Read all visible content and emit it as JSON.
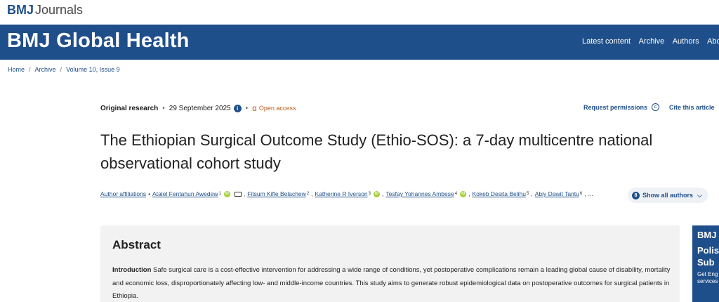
{
  "brand": {
    "bmj": "BMJ",
    "journals": "Journals"
  },
  "header": {
    "title": "BMJ Global Health",
    "nav": [
      "Latest content",
      "Archive",
      "Authors",
      "About"
    ]
  },
  "breadcrumb": [
    "Home",
    "Archive",
    "Volume 10, Issue 9"
  ],
  "meta": {
    "type": "Original research",
    "date": "29 September 2025",
    "info_icon": "i",
    "access": "Open access",
    "request_permissions": "Request permissions",
    "cite": "Cite this article"
  },
  "article": {
    "title": "The Ethiopian Surgical Outcome Study (Ethio-SOS): a 7-day multicentre national observational cohort study"
  },
  "authors": {
    "affiliations_label": "Author affiliations",
    "list": [
      {
        "name": "Atalel Fentahun Awedew",
        "sup": "1"
      },
      {
        "name": "Fitsum Kifle Belachew",
        "sup": "2"
      },
      {
        "name": "Katherine R Iverson",
        "sup": "3"
      },
      {
        "name": "Tesfay Yohannes Ambese",
        "sup": "4"
      },
      {
        "name": "Kokeb Desita Belihu",
        "sup": "5"
      },
      {
        "name": "Abiy Dawit Tantu",
        "sup": "6"
      }
    ],
    "ellipsis": "...",
    "show_all": {
      "count": "8",
      "label": "Show all authors"
    }
  },
  "abstract": {
    "heading": "Abstract",
    "intro_label": "Introduction",
    "intro_text": " Safe surgical care is a cost-effective intervention for addressing a wide range of conditions, yet postoperative complications remain a leading global cause of disability, mortality and economic loss, disproportionately affecting low- and middle-income countries. This study aims to generate robust epidemiological data on postoperative outcomes for surgical patients in Ethiopia."
  },
  "ad": {
    "l1": "BMJ",
    "l2": "Polis",
    "l3": "Sub",
    "l4": "Get Eng",
    "l5": "services"
  },
  "colors": {
    "brand_blue": "#1f4f8a",
    "open_access": "#b85c1e",
    "orcid": "#a6ce39",
    "abstract_bg": "#f2f2f2"
  }
}
